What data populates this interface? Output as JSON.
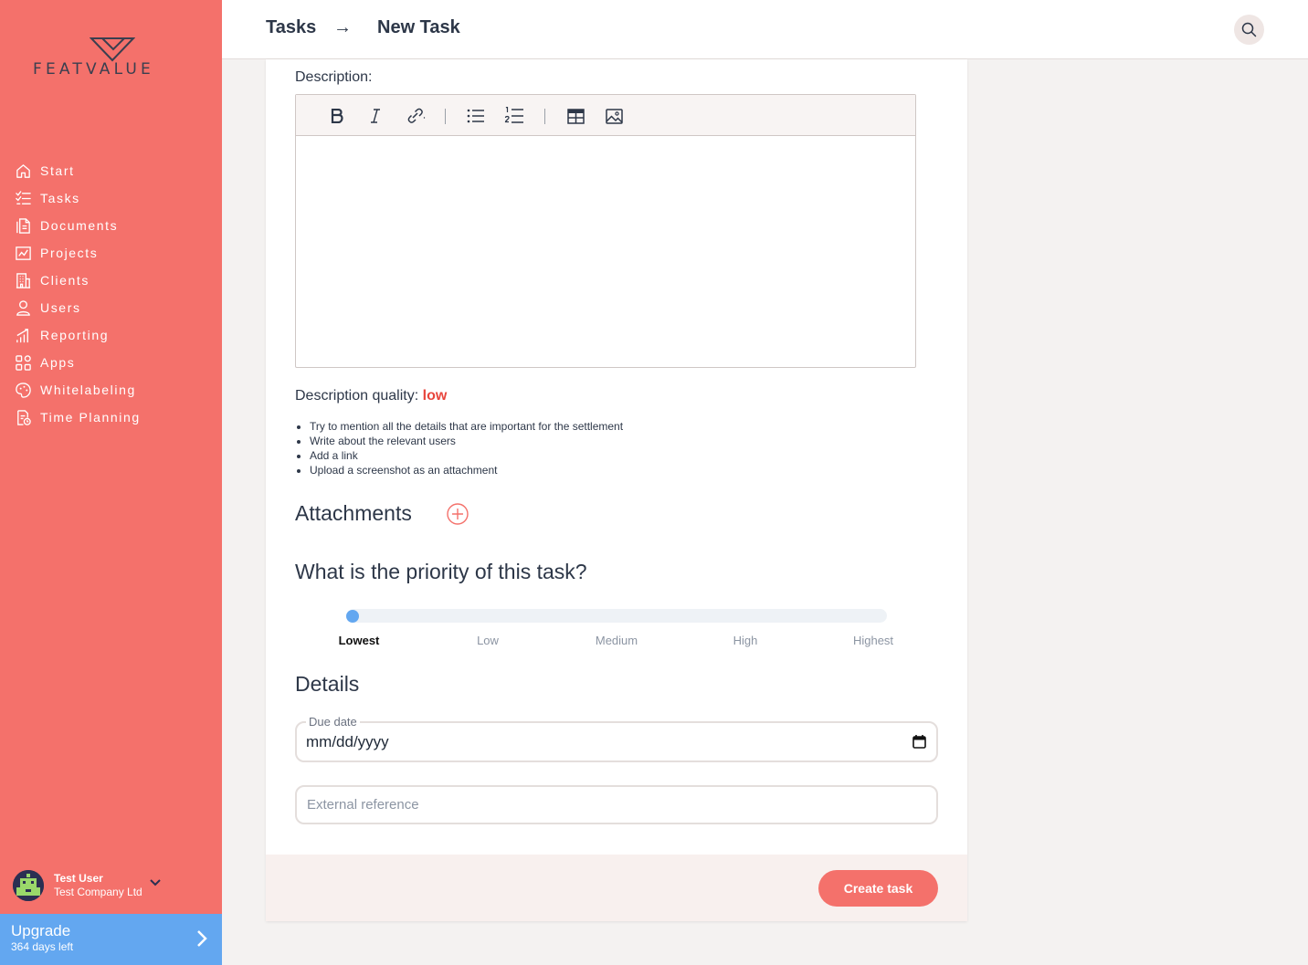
{
  "sidebar": {
    "logo_text": "FEATVALUE",
    "items": [
      {
        "label": "Start",
        "icon": "home-icon"
      },
      {
        "label": "Tasks",
        "icon": "tasks-icon"
      },
      {
        "label": "Documents",
        "icon": "documents-icon"
      },
      {
        "label": "Projects",
        "icon": "projects-icon"
      },
      {
        "label": "Clients",
        "icon": "clients-icon"
      },
      {
        "label": "Users",
        "icon": "users-icon"
      },
      {
        "label": "Reporting",
        "icon": "reporting-icon"
      },
      {
        "label": "Apps",
        "icon": "apps-icon"
      },
      {
        "label": "Whitelabeling",
        "icon": "whitelabeling-icon"
      },
      {
        "label": "Time Planning",
        "icon": "time-planning-icon"
      }
    ],
    "user": {
      "name": "Test User",
      "company": "Test Company Ltd"
    },
    "upgrade": {
      "title": "Upgrade",
      "subtitle": "364 days left"
    }
  },
  "header": {
    "breadcrumb": [
      "Tasks",
      "New Task"
    ],
    "separator": "→"
  },
  "form": {
    "description_label": "Description:",
    "toolbar": [
      "bold-icon",
      "italic-icon",
      "link-icon",
      "bullet-list-icon",
      "numbered-list-icon",
      "table-icon",
      "image-icon"
    ],
    "quality_label": "Description quality:",
    "quality_value": "low",
    "tips": [
      "Try to mention all the details that are important for the settlement",
      "Write about the relevant users",
      "Add a link",
      "Upload a screenshot as an attachment"
    ],
    "attachments_title": "Attachments",
    "priority_title": "What is the priority of this task?",
    "priority_levels": [
      "Lowest",
      "Low",
      "Medium",
      "High",
      "Highest"
    ],
    "priority_selected": "Lowest",
    "details_title": "Details",
    "due_date_label": "Due date",
    "due_date_value": "mm/dd/yyyy",
    "external_ref_placeholder": "External reference",
    "create_button": "Create task"
  },
  "colors": {
    "sidebar": "#f4716b",
    "upgrade": "#63a7f0",
    "accent": "#f4716b",
    "quality_low": "#e8453c",
    "slider_thumb": "#63a7f0"
  }
}
